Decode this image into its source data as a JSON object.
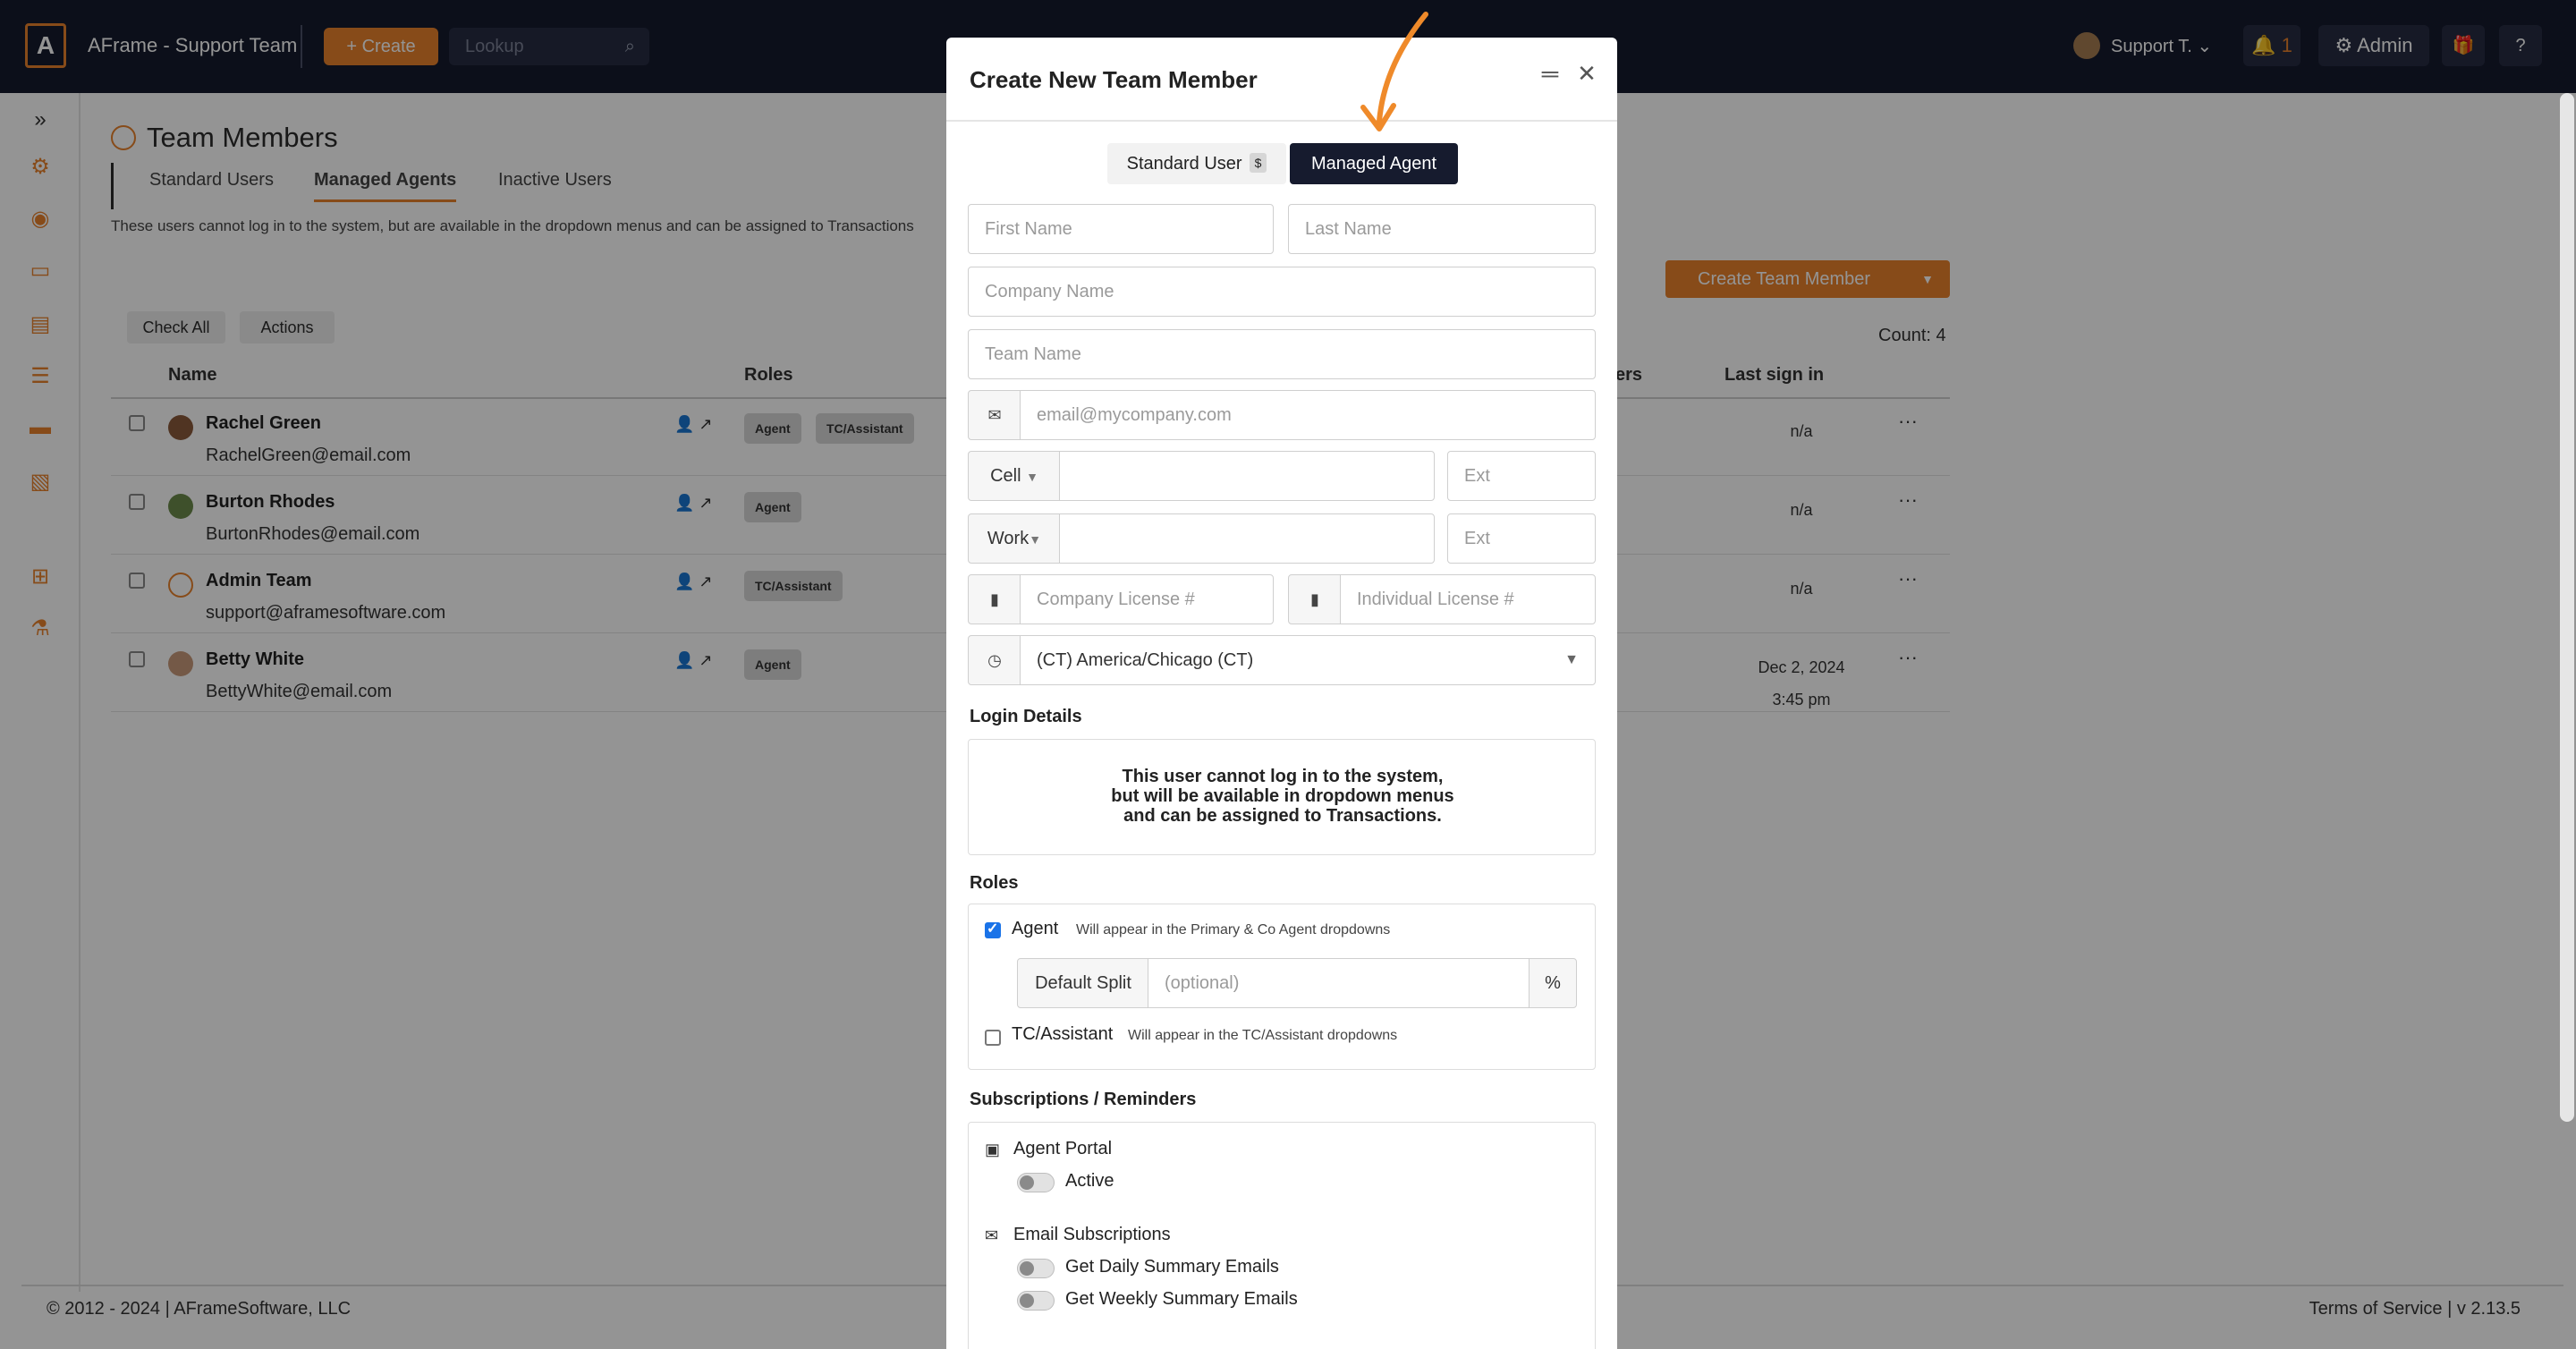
{
  "topbar": {
    "logo_letter": "A",
    "app_title": "AFrame - Support Team",
    "create_label": "+ Create",
    "lookup_placeholder": "Lookup",
    "user_label": "Support T. ⌄",
    "notif_label": "🔔 1",
    "admin_label": "⚙ Admin"
  },
  "page": {
    "title": "Team Members",
    "tabs": [
      "Standard Users",
      "Managed Agents",
      "Inactive Users"
    ],
    "subtitle": "These users cannot log in to the system, but are available in the dropdown menus and can be assigned to Transactions",
    "create_team_member": "Create Team Member",
    "count": "Count: 4",
    "check_all": "Check All",
    "actions": "Actions",
    "columns": [
      "Name",
      "Roles",
      "ers",
      "Last sign in"
    ]
  },
  "rows": [
    {
      "name": "Rachel Green",
      "email": "RachelGreen@email.com",
      "badges": [
        "Agent",
        "TC/Assistant"
      ],
      "last_sign_in": "n/a"
    },
    {
      "name": "Burton Rhodes",
      "email": "BurtonRhodes@email.com",
      "badges": [
        "Agent"
      ],
      "last_sign_in": "n/a"
    },
    {
      "name": "Admin Team",
      "email": "support@aframesoftware.com",
      "badges": [
        "TC/Assistant"
      ],
      "last_sign_in": "n/a"
    },
    {
      "name": "Betty White",
      "email": "BettyWhite@email.com",
      "badges": [
        "Agent"
      ],
      "last_sign_in": "Dec 2, 2024",
      "last_sign_in_time": "3:45 pm"
    }
  ],
  "footer": {
    "copyright": "© 2012 - 2024 | AFrameSoftware, LLC",
    "terms": "Terms of Service | v 2.13.5"
  },
  "modal": {
    "title": "Create New Team Member",
    "standard_user": "Standard User",
    "price_badge": "$",
    "managed_agent": "Managed Agent",
    "first_name": "First Name",
    "last_name": "Last Name",
    "company_name": "Company Name",
    "team_name": "Team Name",
    "email_placeholder": "email@mycompany.com",
    "cell_label": "Cell",
    "work_label": "Work",
    "ext_placeholder": "Ext",
    "company_license": "Company License #",
    "individual_license": "Individual License #",
    "timezone": "(CT) America/Chicago (CT)",
    "login_details_label": "Login Details",
    "login_notice": "This user cannot log in to the system, but will be available in dropdown menus and can be assigned to Transactions.",
    "login_notice_lines": [
      "This user cannot log in to the system,",
      "but will be available in dropdown menus",
      "and can be assigned to Transactions."
    ],
    "roles_label": "Roles",
    "agent_role": "Agent",
    "agent_desc": "Will appear in the Primary & Co Agent dropdowns",
    "default_split": "Default Split",
    "split_placeholder": "(optional)",
    "percent": "%",
    "tc_role": "TC/Assistant",
    "tc_desc": "Will appear in the TC/Assistant dropdowns",
    "subscriptions_label": "Subscriptions / Reminders",
    "agent_portal": "Agent Portal",
    "active": "Active",
    "email_subscriptions": "Email Subscriptions",
    "daily_summary": "Get Daily Summary Emails",
    "weekly_summary": "Get Weekly Summary Emails"
  },
  "colors": {
    "accent": "#e8812b",
    "navy": "#161b2e",
    "checkbox_blue": "#1a73e8"
  }
}
